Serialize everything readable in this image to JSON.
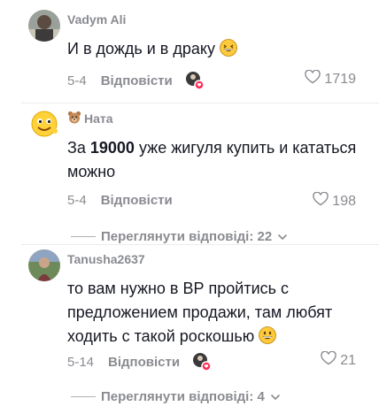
{
  "comments": [
    {
      "author": "Vadym Ali",
      "text": "И в дождь и в драку",
      "date": "5-4",
      "reply_label": "Відповісти",
      "likes": "1719",
      "creator_liked": true
    },
    {
      "author": "Ната",
      "text_bold": "19000",
      "text_before": "За ",
      "text_after": " уже жигуля купить и кататься можно",
      "date": "5-4",
      "reply_label": "Відповісти",
      "likes": "198",
      "view_replies": "Переглянути відповіді: 22"
    },
    {
      "author": "Tanusha2637",
      "text": "то вам нужно в ВР пройтись с предложением продажи, там любят ходить с такой роскошью",
      "date": "5-14",
      "reply_label": "Відповісти",
      "likes": "21",
      "creator_liked": true,
      "view_replies": "Переглянути відповіді: 4"
    }
  ],
  "colors": {
    "text": "#161823",
    "muted": "#8a8b91",
    "like_badge": "#fe2c55"
  },
  "icons": [
    "heart-outline-icon",
    "chevron-down-icon",
    "grin-emoji-icon",
    "bear-emoji-icon"
  ]
}
